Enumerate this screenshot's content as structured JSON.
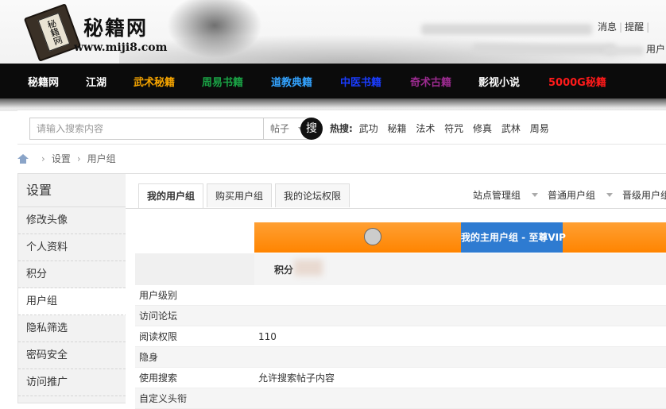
{
  "header": {
    "logo_title": "秘籍网",
    "logo_book_text": "秘籍网",
    "logo_url": "www.miji8.com",
    "top_links": [
      "消息",
      "提醒"
    ],
    "top_links2": "用户"
  },
  "nav": {
    "items": [
      {
        "label": "秘籍网",
        "color": "#ffffff"
      },
      {
        "label": "江湖",
        "color": "#ffffff"
      },
      {
        "label": "武术秘籍",
        "color": "#f5a400"
      },
      {
        "label": "周易书籍",
        "color": "#1aa345"
      },
      {
        "label": "道教典籍",
        "color": "#33a3ff"
      },
      {
        "label": "中医书籍",
        "color": "#1a3cff"
      },
      {
        "label": "奇术古籍",
        "color": "#9b2b8f"
      },
      {
        "label": "影视小说",
        "color": "#ffffff"
      },
      {
        "label": "5000G秘籍",
        "color": "#ff1a1a"
      }
    ]
  },
  "search": {
    "placeholder": "请输入搜索内容",
    "type_selected": "帖子",
    "button_glyph": "搜",
    "hot_label": "热搜:",
    "hot_terms": [
      "武功",
      "秘籍",
      "法术",
      "符咒",
      "修真",
      "武林",
      "周易"
    ]
  },
  "breadcrumb": {
    "items": [
      "设置",
      "用户组"
    ]
  },
  "sidebar": {
    "title": "设置",
    "items": [
      "修改头像",
      "个人资料",
      "积分",
      "用户组",
      "隐私筛选",
      "密码安全",
      "访问推广"
    ]
  },
  "tabs": [
    "我的用户组",
    "购买用户组",
    "我的论坛权限"
  ],
  "group_links": [
    "站点管理组",
    "普通用户组",
    "晋级用户组"
  ],
  "usergroup": {
    "main_group_label": "我的主用户组 - 至尊VIP",
    "score_label": "积分"
  },
  "rows": [
    {
      "key": "用户级别",
      "value": ""
    },
    {
      "key": "访问论坛",
      "value": ""
    },
    {
      "key": "阅读权限",
      "value": "110"
    },
    {
      "key": "隐身",
      "value": ""
    },
    {
      "key": "使用搜索",
      "value": "允许搜索帖子内容"
    },
    {
      "key": "自定义头衔",
      "value": ""
    }
  ]
}
